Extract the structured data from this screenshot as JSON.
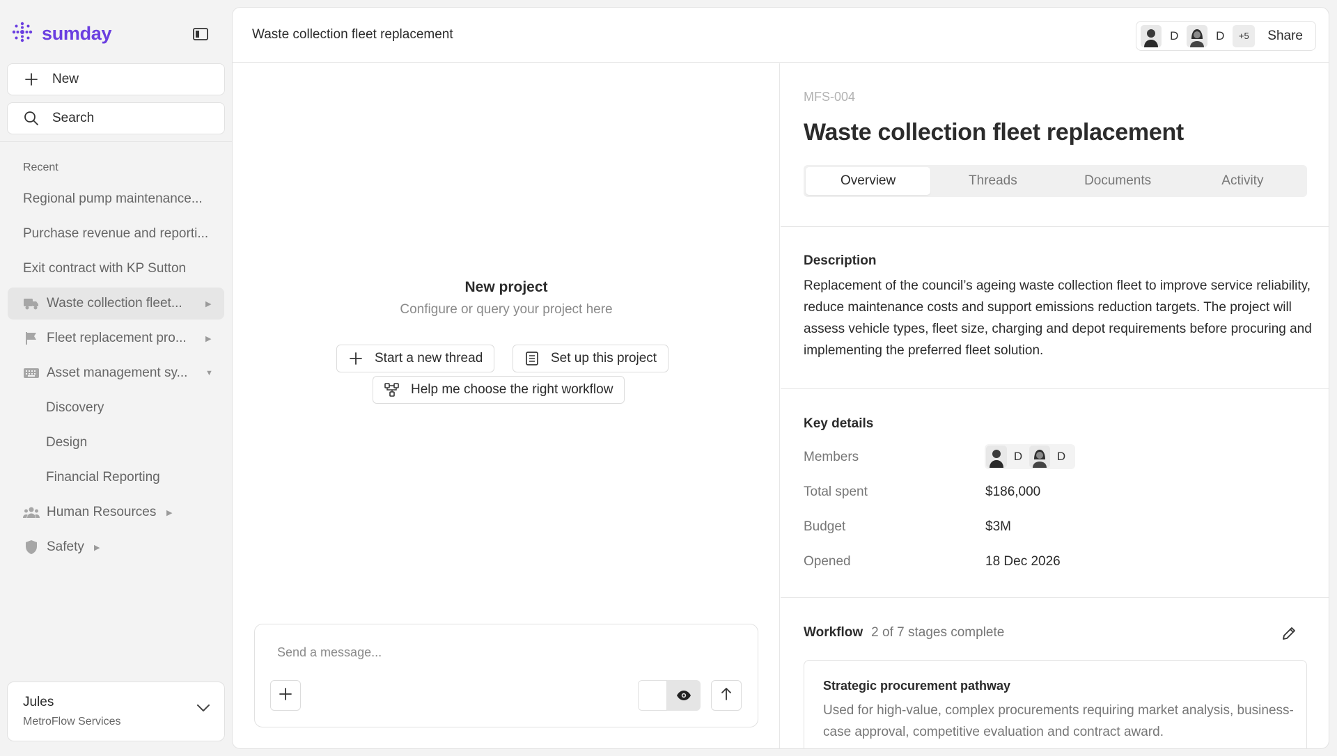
{
  "brand": {
    "name": "sumday",
    "accent": "#6b3fe0"
  },
  "sidebar": {
    "new_label": "New",
    "search_label": "Search",
    "recent_label": "Recent",
    "recent_items": [
      "Regional pump maintenance...",
      "Purchase revenue and reporti...",
      "Exit contract with KP Sutton"
    ],
    "groups": [
      {
        "label": "Waste collection fleet...",
        "icon": "truck-icon"
      },
      {
        "label": "Fleet replacement pro...",
        "icon": "flag-icon"
      },
      {
        "label": "Asset management sy...",
        "icon": "keyboard-icon"
      },
      {
        "label": "Human Resources",
        "icon": "people-icon"
      },
      {
        "label": "Safety",
        "icon": "shield-icon"
      }
    ],
    "sub_items": [
      "Discovery",
      "Design",
      "Financial Reporting"
    ]
  },
  "user": {
    "name": "Jules",
    "org": "MetroFlow Services"
  },
  "header": {
    "title": "Waste collection fleet replacement",
    "collaborators": [
      "D",
      "D"
    ],
    "more_count": "+5",
    "share_label": "Share"
  },
  "center": {
    "title": "New project",
    "subtitle": "Configure or query your project here",
    "actions": [
      "Start a new thread",
      "Set up this project",
      "Help me choose the right workflow"
    ],
    "composer_placeholder": "Send a message..."
  },
  "project": {
    "code": "MFS-004",
    "title": "Waste collection fleet replacement",
    "tabs": [
      "Overview",
      "Threads",
      "Documents",
      "Activity"
    ],
    "active_tab": "Overview",
    "description_title": "Description",
    "description": "Replacement of the council’s ageing waste collection fleet to improve service reliability, reduce maintenance costs and support emissions reduction targets. The project will assess vehicle types, fleet size, charging and depot requirements before procuring and implementing the preferred fleet solution.",
    "key_details_title": "Key details",
    "members_label": "Members",
    "member_initials": [
      "D",
      "D"
    ],
    "total_spent_label": "Total spent",
    "total_spent": "$186,000",
    "budget_label": "Budget",
    "budget": "$3M",
    "opened_label": "Opened",
    "opened": "18 Dec 2026",
    "workflow_title": "Workflow",
    "workflow_progress": "2 of 7 stages complete",
    "workflow_card": {
      "title": "Strategic procurement pathway",
      "description": "Used for high-value, complex procurements requiring market analysis, business-case approval, competitive evaluation and contract award."
    }
  }
}
